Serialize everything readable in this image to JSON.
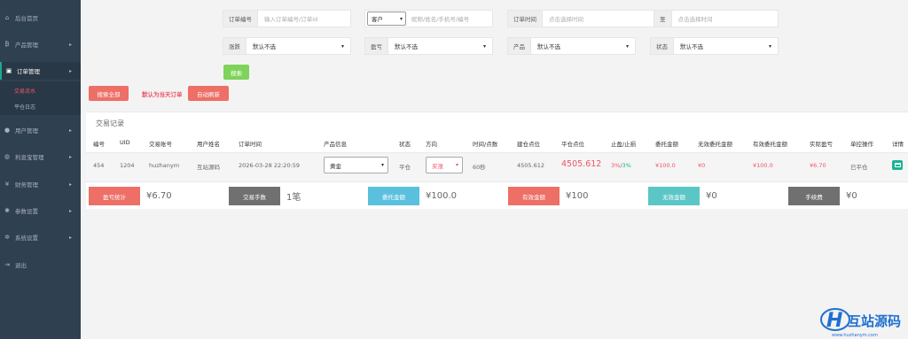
{
  "sidebar": {
    "items": [
      {
        "label": "后台首页",
        "icon": "dashboard-icon",
        "glyph": "⌂",
        "arrow": false
      },
      {
        "label": "产品管理",
        "icon": "bitcoin-icon",
        "glyph": "₿",
        "arrow": true
      },
      {
        "label": "订单管理",
        "icon": "orders-icon",
        "glyph": "▣",
        "arrow": true
      },
      {
        "label": "用户管理",
        "icon": "user-icon",
        "glyph": "●",
        "arrow": true
      },
      {
        "label": "利息宝管理",
        "icon": "globe-icon",
        "glyph": "◍",
        "arrow": true
      },
      {
        "label": "财务管理",
        "icon": "yen-icon",
        "glyph": "¥",
        "arrow": true
      },
      {
        "label": "参数设置",
        "icon": "cog-icon",
        "glyph": "✱",
        "arrow": true
      },
      {
        "label": "系统设置",
        "icon": "cogs-icon",
        "glyph": "✲",
        "arrow": true
      },
      {
        "label": "退出",
        "icon": "logout-icon",
        "glyph": "⇥",
        "arrow": false
      }
    ],
    "sub_items": [
      "交易流水",
      "平仓日志"
    ]
  },
  "filters": {
    "order_no": {
      "label": "订单编号",
      "placeholder": "输入订单编号/订单id"
    },
    "customer": {
      "select": "客户",
      "placeholder": "昵称/姓名/手机号/编号"
    },
    "order_time": {
      "label": "订单时间",
      "placeholder": "点击选择时间",
      "to_label": "至",
      "to_placeholder": "点击选择时间"
    },
    "rise_fall": {
      "label": "涨跌",
      "value": "默认不选"
    },
    "profit_loss": {
      "label": "盈亏",
      "value": "默认不选"
    },
    "product": {
      "label": "产品",
      "value": "默认不选"
    },
    "status": {
      "label": "状态",
      "value": "默认不选"
    },
    "search_button": "搜索",
    "search_all_button": "搜索全部",
    "default_today": "默认为当天订单",
    "auto_refresh_button": "自动刷新"
  },
  "panel": {
    "title": "交易记录",
    "headers": [
      "编号",
      "UID",
      "交易账号",
      "用户姓名",
      "订单时间",
      "产品信息",
      "状态",
      "方向",
      "时间/点数",
      "建仓点位",
      "平仓点位",
      "止盈/止损",
      "委托金额",
      "无效委托金额",
      "有效委托金额",
      "实际盈亏",
      "单控操作",
      "详情"
    ],
    "row": {
      "id": "454",
      "uid": "1204",
      "account": "huzhanym",
      "name": "互站源码",
      "time": "2026-03-28 22:20:59",
      "product": "黄金",
      "status": "平仓",
      "direction": "买涨",
      "duration": "60秒",
      "open_price": "4505.612",
      "close_price": "4505.612",
      "tp_sl_a": "3%",
      "tp_sl_sep": "/",
      "tp_sl_b": "3%",
      "amount": "¥100.0",
      "invalid_amount": "¥0",
      "valid_amount": "¥100.0",
      "profit": "¥6.70",
      "control": "已平仓",
      "detail_icon": "detail-icon"
    }
  },
  "stats": [
    {
      "label": "盈亏统计",
      "value": "¥6.70",
      "color": "#ed6f66"
    },
    {
      "label": "交易手数",
      "value": "1笔",
      "color": "#707070"
    },
    {
      "label": "委托金额",
      "value": "¥100.0",
      "color": "#5bc0de"
    },
    {
      "label": "有效金额",
      "value": "¥100",
      "color": "#ed6f66"
    },
    {
      "label": "无效金额",
      "value": "¥0",
      "color": "#5bc6c6"
    },
    {
      "label": "手续费",
      "value": "¥0",
      "color": "#707070"
    }
  ],
  "colors": {
    "sidebar_bg": "#2f4050",
    "accent_red": "#ed5565",
    "button_green": "#7ed35b",
    "button_red": "#ed6f66",
    "profit_green": "#1ab394"
  },
  "watermark": {
    "brand": "互站源码",
    "url": "www.huzhanym.com"
  }
}
